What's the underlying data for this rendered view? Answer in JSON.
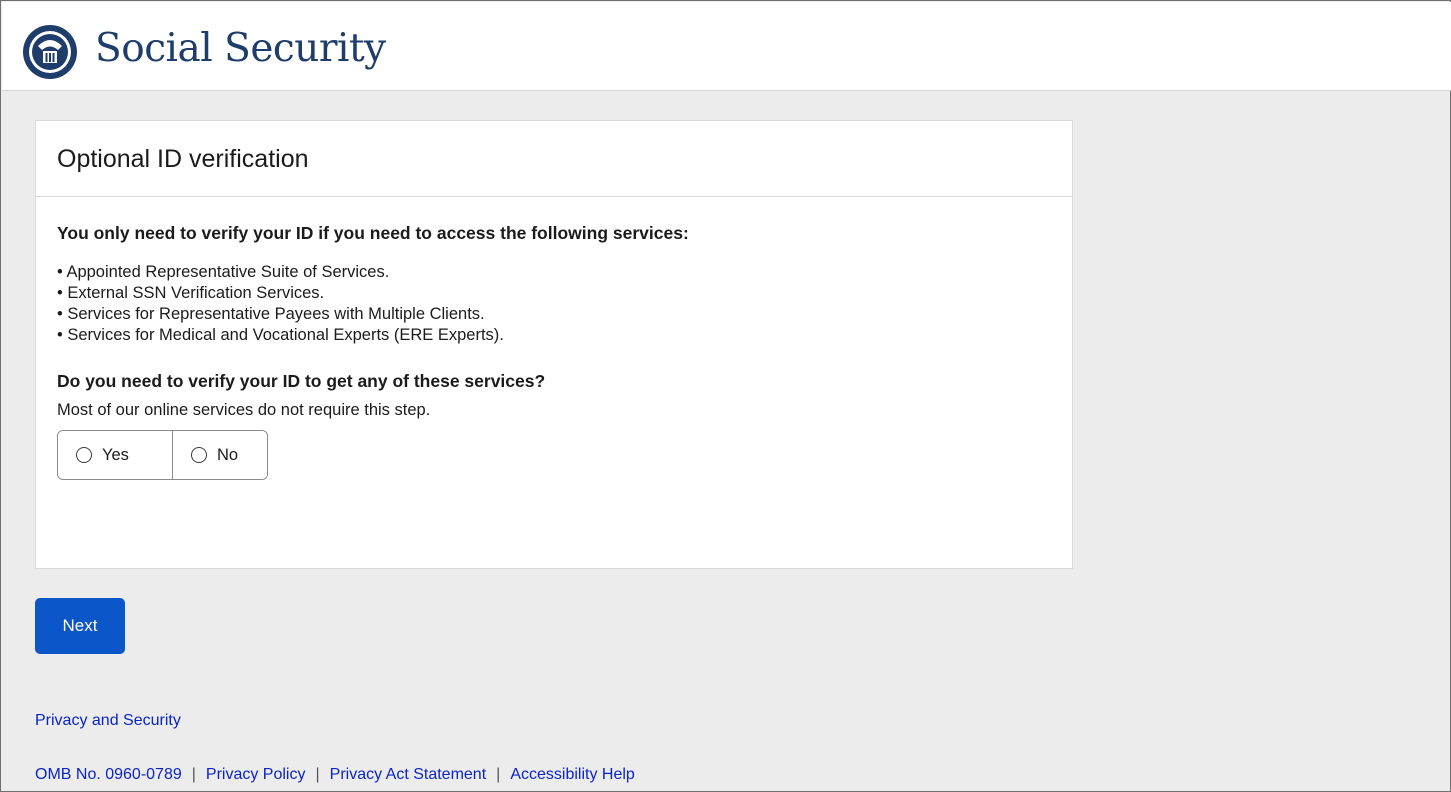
{
  "header": {
    "brand": "Social Security",
    "logo_icon": "ssa-seal-icon"
  },
  "card": {
    "title": "Optional ID verification",
    "lead": "You only need to verify your ID if you need to access the following services:",
    "services": [
      "• Appointed Representative Suite of Services.",
      "• External SSN Verification Services.",
      "• Services for Representative Payees with Multiple Clients.",
      "• Services for Medical and Vocational Experts (ERE Experts)."
    ],
    "question": "Do you need to verify your ID to get any of these services?",
    "hint": "Most of our online services do not require this step.",
    "options": {
      "yes_label": "Yes",
      "no_label": "No",
      "selected": null
    }
  },
  "actions": {
    "next_label": "Next"
  },
  "footer": {
    "privacy_security": "Privacy and Security",
    "omb": "OMB No. 0960-0789",
    "privacy_policy": "Privacy Policy",
    "privacy_act": "Privacy Act Statement",
    "accessibility": "Accessibility Help",
    "separator": "|"
  },
  "colors": {
    "brand_text": "#1f3d6b",
    "primary_button": "#0b56c8",
    "link": "#0b24c8",
    "page_bg": "#ececec"
  }
}
